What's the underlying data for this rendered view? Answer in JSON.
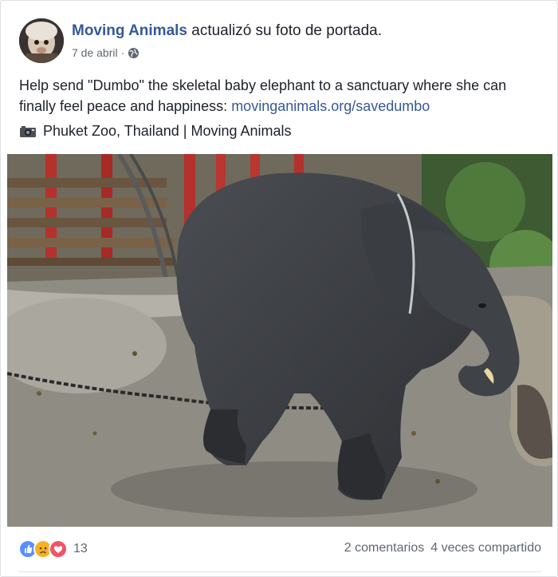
{
  "post": {
    "author": "Moving Animals",
    "action": "actualizó su foto de portada.",
    "date": "7 de abril",
    "separator": "·",
    "text": "Help send \"Dumbo\" the skeletal baby elephant to a sanctuary where she can finally feel peace and happiness: ",
    "link": "movinganimals.org/savedumbo",
    "caption": "Phuket Zoo, Thailand | Moving Animals",
    "privacy_icon": "globe-icon",
    "caption_icon": "camera-icon"
  },
  "footer": {
    "reaction_icons": [
      "like-icon",
      "sad-icon",
      "love-icon"
    ],
    "reaction_count": "13",
    "comments": "2 comentarios",
    "shares": "4 veces compartido"
  },
  "colors": {
    "link": "#365899",
    "text": "#1d2129",
    "meta": "#616770",
    "like": "#5890ff",
    "sad": "#f7b125",
    "love": "#f25268"
  }
}
